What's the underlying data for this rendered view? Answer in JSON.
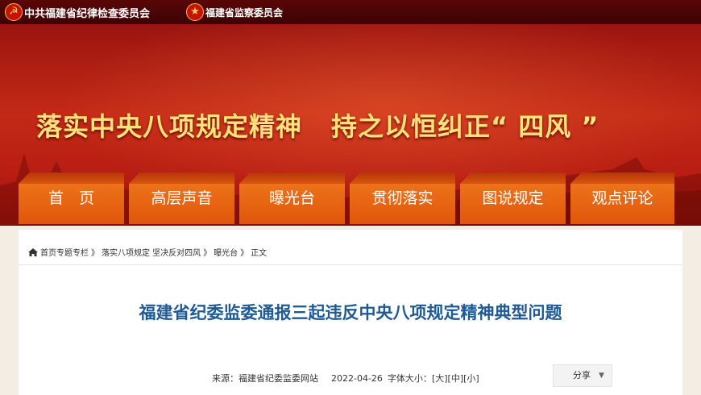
{
  "header": {
    "org1": "中共福建省纪律检查委员会",
    "org2": "福建省监察委员会",
    "icon1": "party-emblem-icon",
    "icon2": "national-emblem-icon"
  },
  "banner": {
    "slogan_part1": "落实中央八项规定精神",
    "slogan_part2": "持之以恒纠正“ 四风 ”"
  },
  "nav": {
    "items": [
      {
        "label": "首　页"
      },
      {
        "label": "高层声音"
      },
      {
        "label": "曝光台"
      },
      {
        "label": "贯彻落实"
      },
      {
        "label": "图说规定"
      },
      {
        "label": "观点评论"
      }
    ]
  },
  "breadcrumb": {
    "icon": "home-icon",
    "items": [
      "首页专题专栏",
      "落实八项规定 坚决反对四风",
      "曝光台"
    ],
    "separator": "》",
    "current": "正文"
  },
  "article": {
    "title": "福建省纪委监委通报三起违反中央八项规定精神典型问题",
    "source": "来源：福建省纪委监委网站",
    "date": "2022-04-26",
    "font_size_label": "字体大小：",
    "font_large": "[大]",
    "font_medium": "[中]",
    "font_small": "[小]"
  },
  "share": {
    "label": "分享",
    "icon": "chevron-down-icon"
  },
  "colors": {
    "top_bar": "#4a0505",
    "banner": "#b81d12",
    "slogan": "#ffe27a",
    "nav": "#e8651a",
    "title": "#1e5a94"
  }
}
